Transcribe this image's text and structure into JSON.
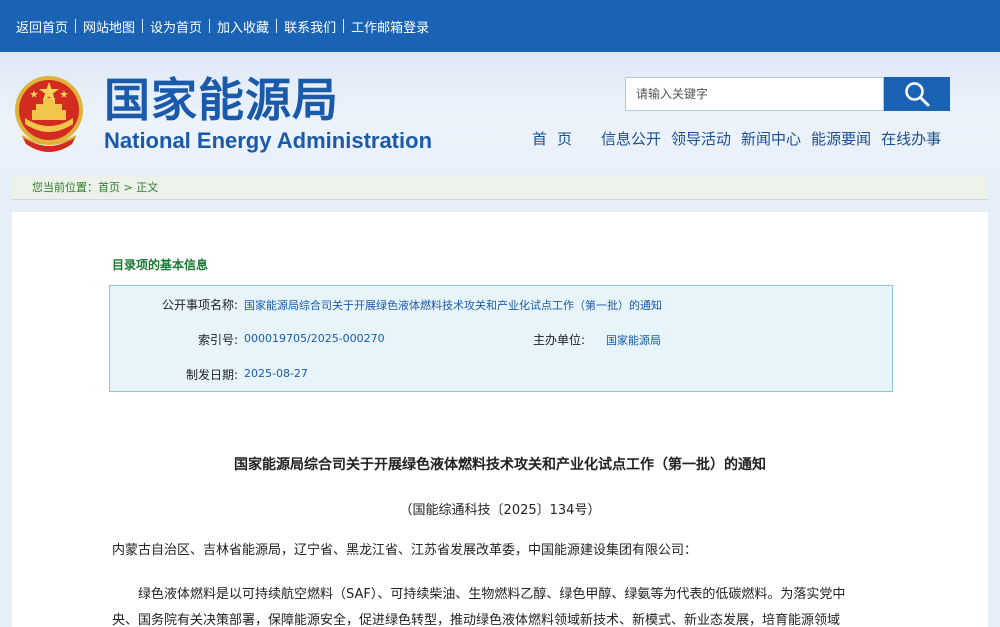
{
  "topbar": {
    "links": [
      "返回首页",
      "网站地图",
      "设为首页",
      "加入收藏",
      "联系我们",
      "工作邮箱登录"
    ]
  },
  "header": {
    "title_cn": "国家能源局",
    "title_en": "National Energy Administration",
    "search_placeholder": "请输入关键字",
    "nav": [
      "首页",
      "信息公开",
      "领导活动",
      "新闻中心",
      "能源要闻",
      "在线办事"
    ]
  },
  "breadcrumb": {
    "label": "您当前位置：",
    "home": "首页",
    "sep": " > ",
    "current": "正文"
  },
  "info": {
    "section_title": "目录项的基本信息",
    "name_label": "公开事项名称:",
    "name_value": "国家能源局综合司关于开展绿色液体燃料技术攻关和产业化试点工作（第一批）的通知",
    "index_label": "索引号:",
    "index_value": "000019705/2025-000270",
    "org_label": "主办单位:",
    "org_value": "国家能源局",
    "date_label": "制发日期:",
    "date_value": "2025-08-27"
  },
  "document": {
    "title": "国家能源局综合司关于开展绿色液体燃料技术攻关和产业化试点工作（第一批）的通知",
    "number": "（国能综通科技〔2025〕134号）",
    "recipients": "内蒙古自治区、吉林省能源局，辽宁省、黑龙江省、江苏省发展改革委，中国能源建设集团有限公司：",
    "body_line1": "绿色液体燃料是以可持续航空燃料（SAF）、可持续柴油、生物燃料乙醇、绿色甲醇、绿氨等为代表的低碳燃料。为落实党中",
    "body_line2": "央、国务院有关决策部署，保障能源安全，促进绿色转型，推动绿色液体燃料领域新技术、新模式、新业态发展，培育能源领域"
  },
  "colors": {
    "topbar": "#1a63b4",
    "brand_blue": "#1a5aab",
    "green_label": "#1a7a32",
    "info_bg": "#e7f5fa"
  }
}
